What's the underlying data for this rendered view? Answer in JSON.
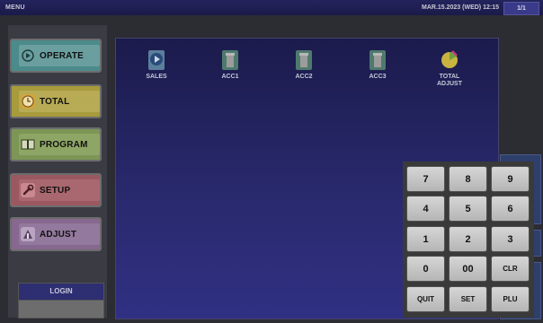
{
  "topbar": {
    "title": "MENU",
    "datetime": "MAR.15.2023 (WED) 12:15",
    "page": "1/1"
  },
  "menu": {
    "operate": "OPERATE",
    "total": "TOTAL",
    "program": "PROGRAM",
    "setup": "SETUP",
    "adjust": "ADJUST"
  },
  "login": {
    "label": "LOGIN"
  },
  "apps": {
    "sales": "SALES",
    "acc1": "ACC1",
    "acc2": "ACC2",
    "acc3": "ACC3",
    "total_adjust_line1": "TOTAL",
    "total_adjust_line2": "ADJUST"
  },
  "keypad": {
    "k7": "7",
    "k8": "8",
    "k9": "9",
    "k4": "4",
    "k5": "5",
    "k6": "6",
    "k1": "1",
    "k2": "2",
    "k3": "3",
    "k0": "0",
    "k00": "00",
    "clr": "CLR",
    "quit": "QUIT",
    "set": "SET",
    "plu": "PLU"
  }
}
